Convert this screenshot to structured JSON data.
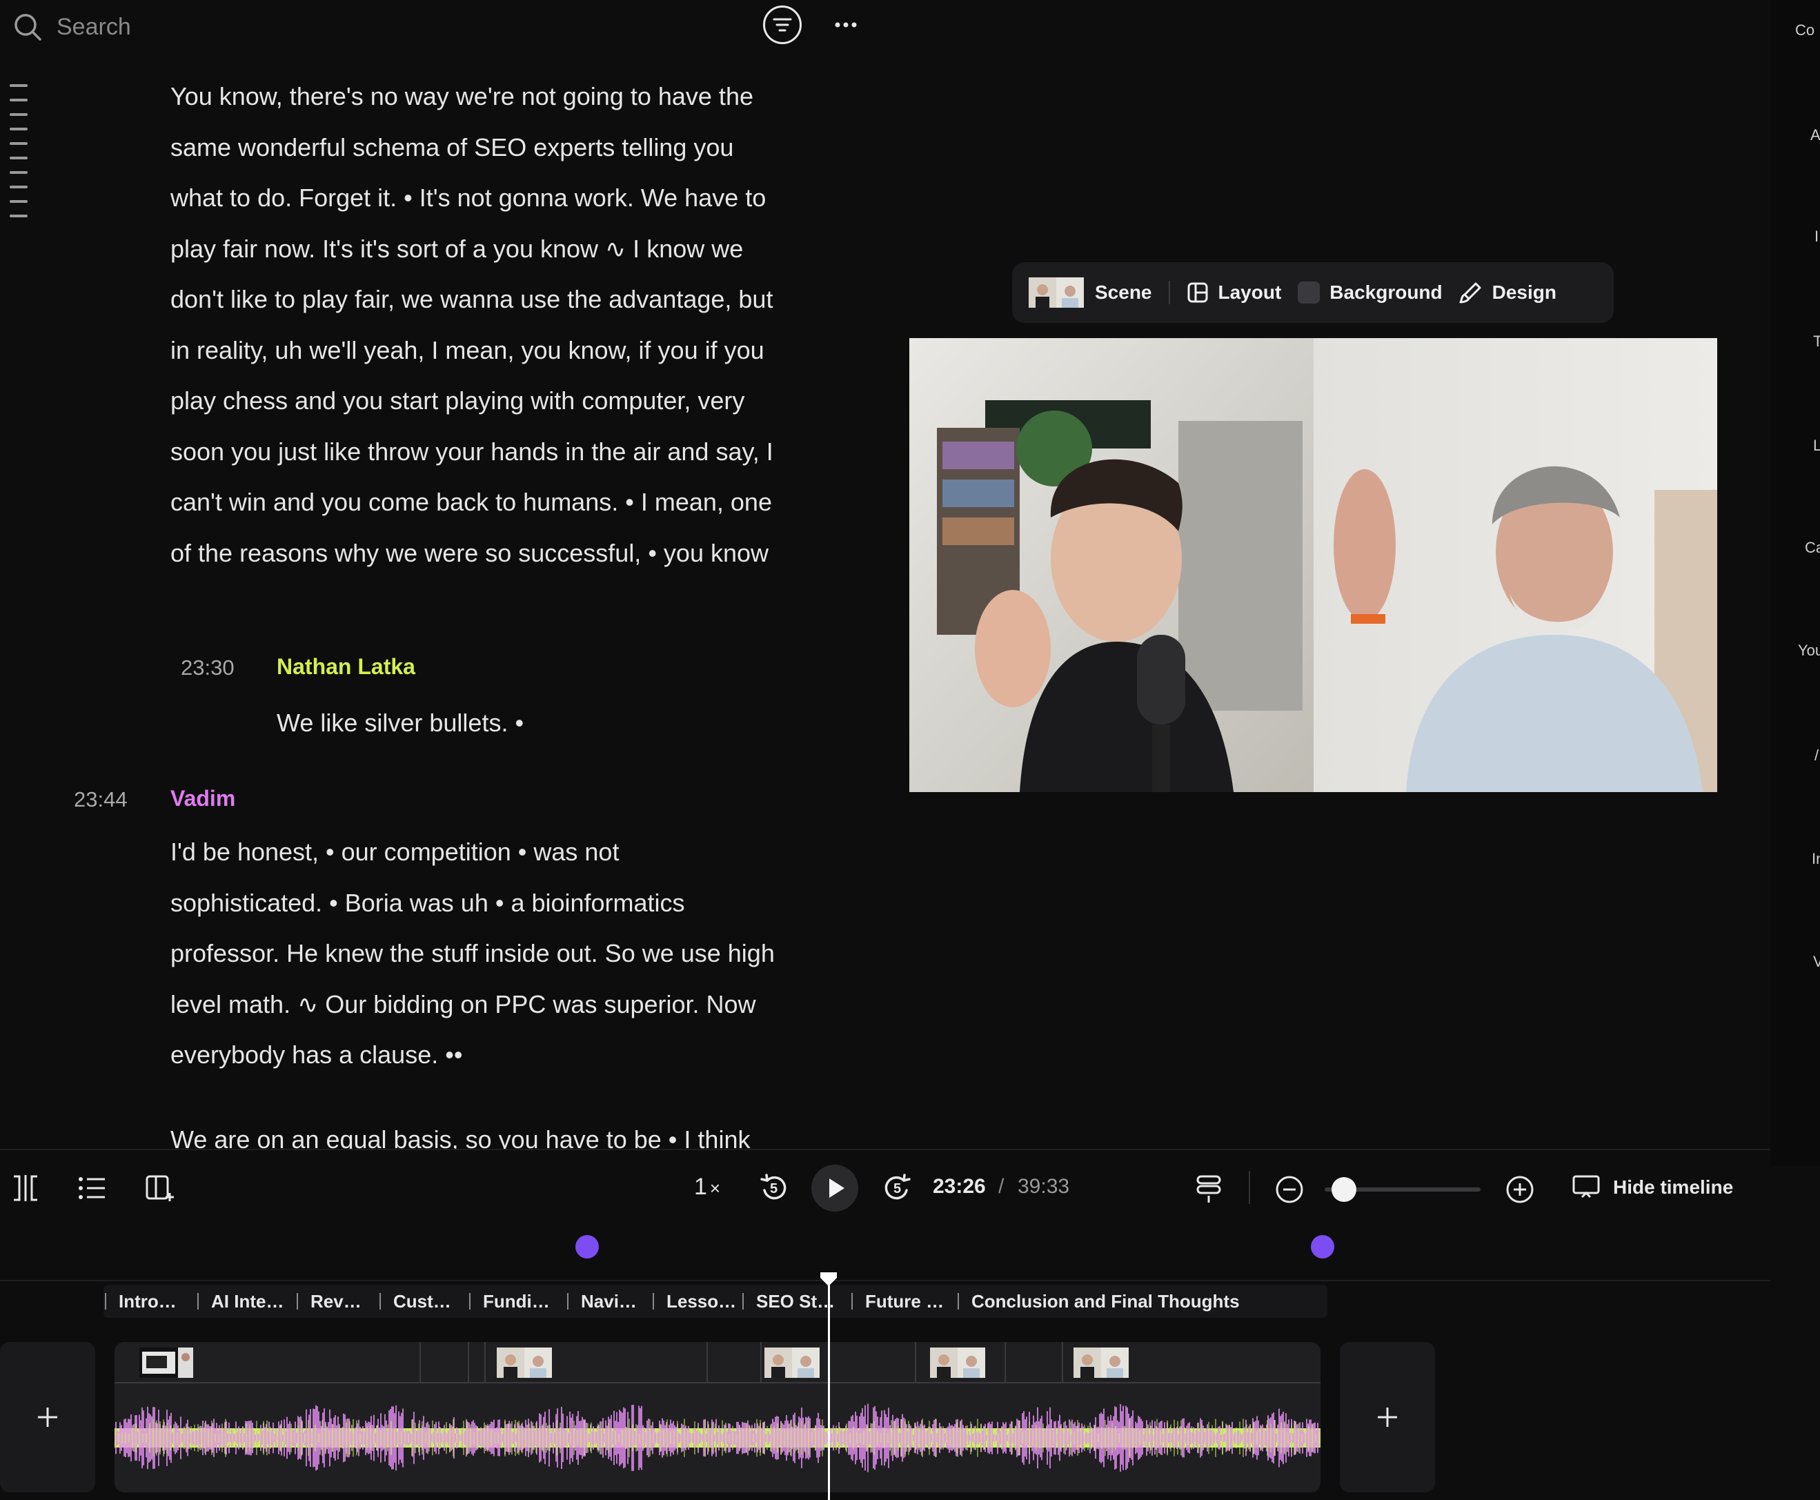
{
  "search": {
    "placeholder": "Search"
  },
  "transcript": {
    "blocks": [
      {
        "text": "You know, there's no way we're not going to have the same wonderful schema of SEO experts telling you what to do. Forget it. • It's not gonna work. We have to play fair now. It's it's sort of a you know ∿ I know we don't like to play fair, we wanna use the advantage, but in reality, uh we'll yeah, I mean, you know, if you if you play chess and you start playing with computer, very soon you just like throw your hands in the air and say, I can't win and you come back to humans. • I mean, one of the reasons why we were so successful, • you know"
      },
      {
        "timestamp": "23:30",
        "speaker": "Nathan Latka",
        "text": "We like silver bullets. •"
      },
      {
        "timestamp": "23:44",
        "speaker": "Vadim",
        "text": "I'd be honest, • our competition • was not sophisticated. • Boria was uh • a bioinformatics professor. He knew the stuff inside out. So we use high level math. ∿ Our bidding on PPC was superior. Now everybody has a clause. ••"
      },
      {
        "text": "We are on an equal basis, so you have to be • I think"
      }
    ]
  },
  "scene_toolbar": {
    "scene": "Scene",
    "layout": "Layout",
    "background": "Background",
    "design": "Design"
  },
  "right_panel_labels": [
    "Co",
    "A",
    "I",
    "T",
    "L",
    "Ca",
    "You",
    "/",
    "In",
    "V"
  ],
  "player": {
    "speed": "1",
    "speed_unit": "×",
    "rewind_seconds": "5",
    "forward_seconds": "5",
    "current_time": "23:26",
    "separator": "/",
    "total_time": "39:33",
    "hide_timeline": "Hide timeline",
    "zoom_level": 0.05
  },
  "timeline": {
    "playhead_fraction": 0.592,
    "chapters": [
      "Intro…",
      "AI Inte…",
      "Rev…",
      "Cust…",
      "Fundi…",
      "Navi…",
      "Lesso…",
      "SEO St…",
      "Future …",
      "Conclusion and Final Thoughts"
    ]
  },
  "colors": {
    "speaker_nathan": "#d4f04a",
    "speaker_vadim": "#e07cf0",
    "waveform_a": "#e58ff2",
    "waveform_b": "#c8f060",
    "marker": "#7b4df2"
  }
}
